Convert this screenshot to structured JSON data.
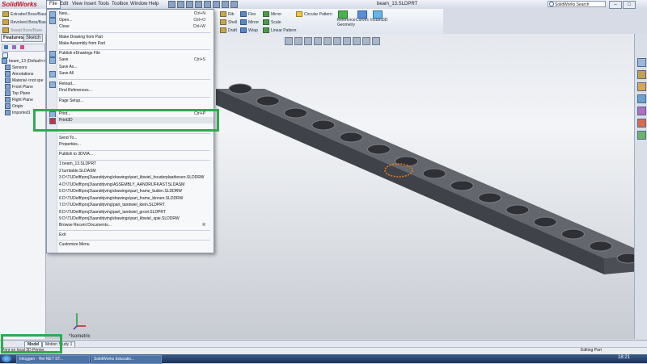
{
  "app": {
    "logo": "SolidWorks",
    "window_title": "beam_13.SLDPRT",
    "search_placeholder": "SolidWorks Search",
    "window_buttons": [
      "–",
      "□",
      "×"
    ]
  },
  "menubar": [
    "File",
    "Edit",
    "View",
    "Insert",
    "Tools",
    "Toolbox",
    "Window",
    "Help"
  ],
  "ribbon": {
    "left_items": [
      "Extruded Boss/Base",
      "Revolved Boss/Base",
      "Swept Boss/Base"
    ],
    "items": [
      "Rib",
      "Shell",
      "Draft",
      "Flex",
      "Mirror",
      "Wrap",
      "Mirror",
      "Scale",
      "Linear Pattern",
      "Circular Pattern",
      "Reference Geometry",
      "Curves",
      "Instant3D"
    ]
  },
  "left_panel": {
    "tabs": [
      "Features",
      "Sketch"
    ],
    "tree": [
      {
        "label": "beam_13 (Default<<",
        "icon": "part-icon"
      },
      {
        "label": "Sensors",
        "icon": "sensor-icon"
      },
      {
        "label": "Annotations",
        "icon": "annotation-icon"
      },
      {
        "label": "Material <not spe",
        "icon": "material-icon"
      },
      {
        "label": "Front Plane",
        "icon": "plane-icon"
      },
      {
        "label": "Top Plane",
        "icon": "plane-icon"
      },
      {
        "label": "Right Plane",
        "icon": "plane-icon"
      },
      {
        "label": "Origin",
        "icon": "origin-icon"
      },
      {
        "label": "Imported1",
        "icon": "imported-icon"
      }
    ]
  },
  "file_menu": {
    "items": [
      {
        "label": "New...",
        "shortcut": "Ctrl+N"
      },
      {
        "label": "Open...",
        "shortcut": "Ctrl+O"
      },
      {
        "label": "Close",
        "shortcut": "Ctrl+W"
      },
      {
        "label": "Make Drawing from Part",
        "shortcut": ""
      },
      {
        "label": "Make Assembly from Part",
        "shortcut": ""
      },
      {
        "label": "Publish eDrawings File",
        "shortcut": ""
      },
      {
        "label": "Save",
        "shortcut": "Ctrl+S"
      },
      {
        "label": "Save As...",
        "shortcut": ""
      },
      {
        "label": "Save All",
        "shortcut": ""
      },
      {
        "label": "Reload...",
        "shortcut": ""
      },
      {
        "label": "Find References...",
        "shortcut": ""
      },
      {
        "label": "Page Setup...",
        "shortcut": ""
      },
      {
        "label": "Print...",
        "shortcut": "Ctrl+P"
      },
      {
        "label": "Print3D",
        "shortcut": ""
      },
      {
        "label": "Send To...",
        "shortcut": ""
      },
      {
        "label": "Properties...",
        "shortcut": ""
      },
      {
        "label": "Publish to 3DVIA...",
        "shortcut": ""
      },
      {
        "label": "1 beam_13.SLDPRT",
        "shortcut": ""
      },
      {
        "label": "2 turntable.SLDASM",
        "shortcut": ""
      },
      {
        "label": "3 D:\\TUDelft\\proj3\\aandrijving\\drawings\\part_kbwiel_houderplaatboven.SLDDRW",
        "shortcut": ""
      },
      {
        "label": "4 D:\\TUDelft\\proj3\\aandrijving\\ASSEMBLY_AANDRIJFKAST.SLDASM",
        "shortcut": ""
      },
      {
        "label": "5 D:\\TUDelft\\proj3\\aandrijving\\drawings\\part_frame_buiten.SLDDRW",
        "shortcut": ""
      },
      {
        "label": "6 D:\\TUDelft\\proj3\\aandrijving\\drawings\\part_frame_binnen.SLDDRW",
        "shortcut": ""
      },
      {
        "label": "7 D:\\TUDelft\\proj3\\aandrijving\\part_tandwiel_klein.SLDPRT",
        "shortcut": ""
      },
      {
        "label": "8 D:\\TUDelft\\proj3\\aandrijving\\part_tandwiel_groot.SLDPRT",
        "shortcut": ""
      },
      {
        "label": "9 D:\\TUDelft\\proj3\\aandrijving\\drawings\\part_kbwiel_spie.SLDDRW",
        "shortcut": ""
      },
      {
        "label": "Browse Recent Documents...",
        "shortcut": "R"
      },
      {
        "label": "Exit",
        "shortcut": ""
      },
      {
        "label": "Customize Menu",
        "shortcut": ""
      }
    ]
  },
  "viewport": {
    "view_label": "*Isometric"
  },
  "bottom": {
    "tabs": [
      "Model",
      "Motion Study 1"
    ],
    "status_left": "Print on local 3D Printer.",
    "status_right": "Editing Part"
  },
  "taskbar": {
    "items": [
      "Inloggen - Het NET ST...",
      "SolidWorks Educatio..."
    ],
    "clock": "18:21"
  },
  "colors": {
    "highlight": "#32a852",
    "beam_body": "#55585f",
    "selection": "#e07a1c"
  }
}
